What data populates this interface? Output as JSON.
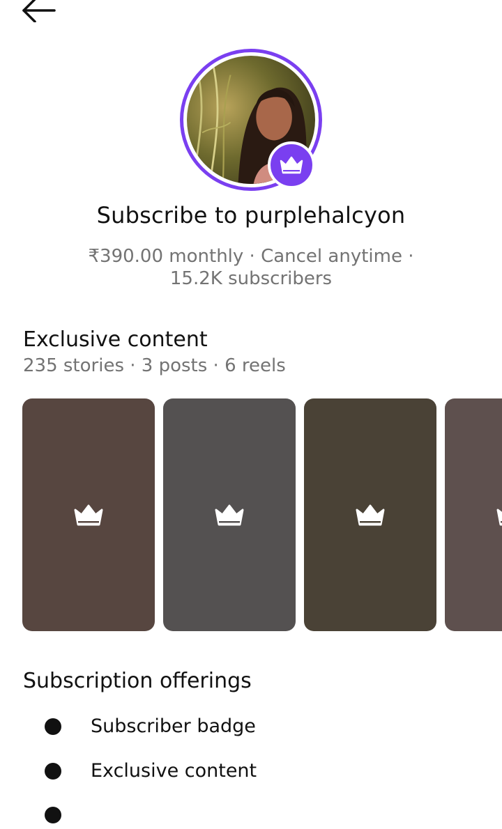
{
  "header": {
    "back_icon": "arrow-left-icon"
  },
  "profile": {
    "title": "Subscribe to purplehalcyon",
    "subtitle": "₹390.00 monthly · Cancel anytime · 15.2K subscribers",
    "ring_color": "#7a3ff0",
    "badge_icon": "crown-icon"
  },
  "exclusive": {
    "title": "Exclusive content",
    "summary": "235 stories · 3 posts · 6 reels",
    "tiles": [
      {
        "color": "#574640",
        "icon": "crown-icon"
      },
      {
        "color": "#545151",
        "icon": "crown-icon"
      },
      {
        "color": "#4a4236",
        "icon": "crown-icon"
      },
      {
        "color": "#5e504e",
        "icon": "crown-icon"
      }
    ]
  },
  "offerings": {
    "title": "Subscription offerings",
    "items": [
      {
        "label": "Subscriber badge"
      },
      {
        "label": "Exclusive content"
      }
    ]
  }
}
